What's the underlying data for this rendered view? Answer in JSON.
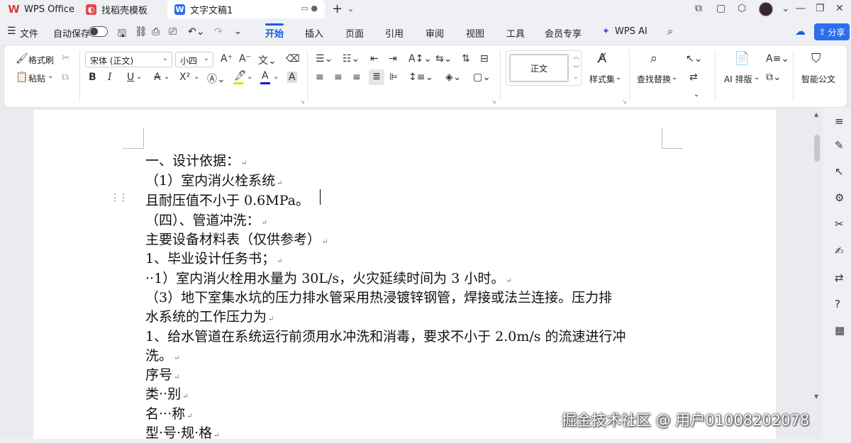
{
  "titlebar": {
    "tabs": [
      {
        "label": "WPS Office"
      },
      {
        "label": "找稻壳模板"
      },
      {
        "label": "文字文稿1"
      }
    ],
    "new_tab": "+",
    "dropdown": "⌄"
  },
  "menubar": {
    "file": "文件",
    "autosave": "自动保存",
    "tabs": [
      "开始",
      "插入",
      "页面",
      "引用",
      "审阅",
      "视图",
      "工具",
      "会员专享"
    ],
    "wps_ai": "WPS AI",
    "share": "分享",
    "active_tab": "开始",
    "accent_color": "#1a5fe0"
  },
  "ribbon": {
    "format_painter": "格式刷",
    "paste": "粘贴",
    "font_name": "宋体 (正文)",
    "font_size": "小四",
    "style_normal": "正文",
    "style_set": "样式集",
    "find_replace": "查找替换",
    "ai_layout": "AI 排版",
    "smart_doc": "智能公文",
    "bold": "B",
    "italic": "I",
    "underline": "U",
    "strike": "A",
    "superscript": "X²",
    "font_color_label": "A",
    "highlight_color": "#e8e000",
    "font_color": "#1a1ad0",
    "char_shade": "A"
  },
  "document": {
    "lines": [
      "一、设计依据：",
      "（1）室内消火栓系统",
      "且耐压值不小于 0.6MPa。",
      "（四）、管道冲洗：",
      "主要设备材料表（仅供参考）",
      "1、毕业设计任务书；",
      "··1）室内消火栓用水量为 30L/s，火灾延续时间为 3 小时。",
      "（3）地下室集水坑的压力排水管采用热浸镀锌钢管，焊接或法兰连接。压力排",
      "水系统的工作压力为",
      "1、给水管道在系统运行前须用水冲洗和消毒，要求不小于 2.0m/s 的流速进行冲",
      "洗。",
      "序号",
      "类··别",
      "名···称",
      "型·号·规·格"
    ]
  },
  "watermark": "掘金技术社区 @ 用户01008202078"
}
